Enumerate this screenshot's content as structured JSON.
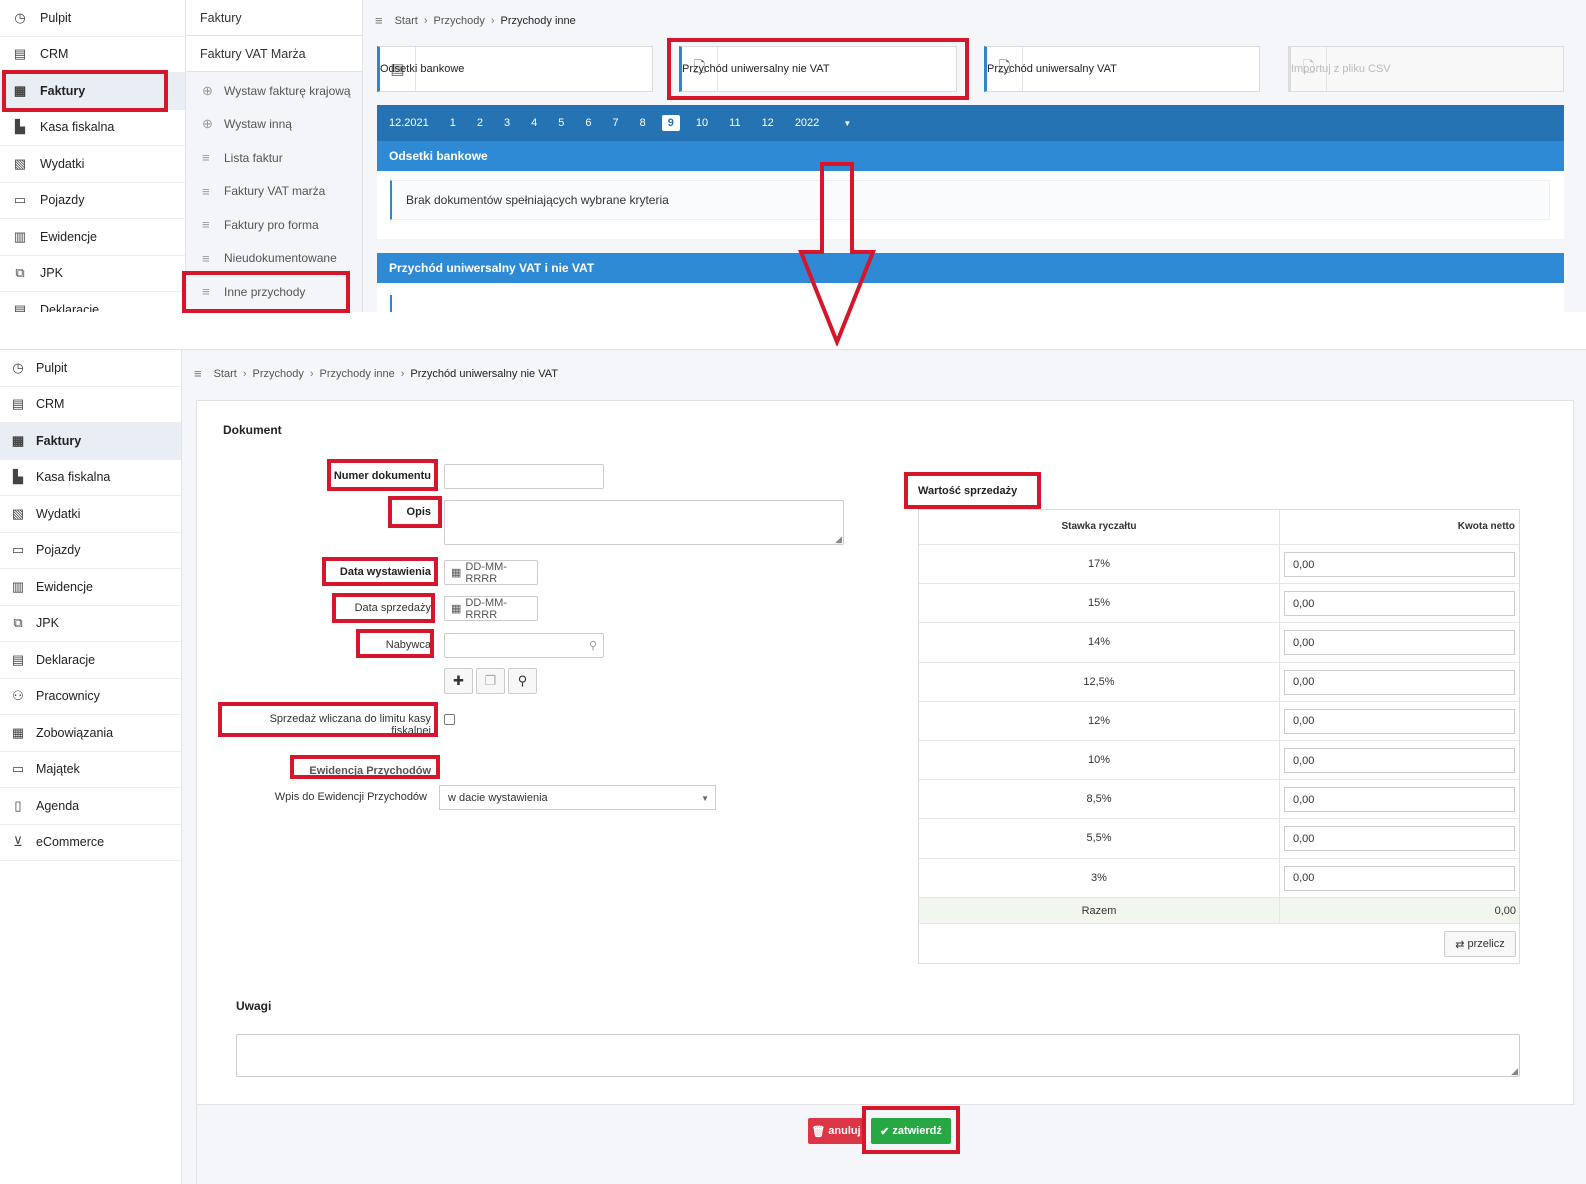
{
  "colors": {
    "accent": "#2f86c8",
    "month_bar": "#2673b3",
    "section_header": "#2f8ad6",
    "highlight": "#d6172b",
    "cancel": "#dc3545",
    "confirm": "#28a745"
  },
  "top": {
    "nav": [
      {
        "label": "Pulpit",
        "icon": "dashboard-icon"
      },
      {
        "label": "CRM",
        "icon": "crm-icon"
      },
      {
        "label": "Faktury",
        "icon": "invoice-icon"
      },
      {
        "label": "Kasa fiskalna",
        "icon": "cash-register-icon"
      },
      {
        "label": "Wydatki",
        "icon": "expenses-icon"
      },
      {
        "label": "Pojazdy",
        "icon": "car-icon"
      },
      {
        "label": "Ewidencje",
        "icon": "records-icon"
      },
      {
        "label": "JPK",
        "icon": "jpk-icon"
      },
      {
        "label": "Deklaracje",
        "icon": "declarations-icon"
      }
    ],
    "subnav": {
      "headers": [
        "Faktury",
        "Faktury VAT Marża"
      ],
      "items": [
        "Wystaw fakturę krajową",
        "Wystaw inną",
        "Lista faktur",
        "Faktury VAT marża",
        "Faktury pro forma",
        "Nieudokumentowane",
        "Inne przychody"
      ]
    },
    "breadcrumb": [
      "Start",
      "Przychody",
      "Przychody inne"
    ],
    "actions": [
      "Odsetki bankowe",
      "Przychód uniwersalny nie VAT",
      "Przychód uniwersalny VAT",
      "Importuj z pliku CSV"
    ],
    "months": {
      "start": "12.2021",
      "items": [
        "1",
        "2",
        "3",
        "4",
        "5",
        "6",
        "7",
        "8",
        "9",
        "10",
        "11",
        "12"
      ],
      "active": "9",
      "year": "2022"
    },
    "section1": {
      "title": "Odsetki bankowe",
      "empty": "Brak dokumentów spełniających wybrane kryteria"
    },
    "section2": {
      "title": "Przychód uniwersalny VAT i nie VAT"
    }
  },
  "bottom": {
    "nav": [
      {
        "label": "Pulpit",
        "icon": "dashboard-icon"
      },
      {
        "label": "CRM",
        "icon": "crm-icon"
      },
      {
        "label": "Faktury",
        "icon": "invoice-icon"
      },
      {
        "label": "Kasa fiskalna",
        "icon": "cash-register-icon"
      },
      {
        "label": "Wydatki",
        "icon": "expenses-icon"
      },
      {
        "label": "Pojazdy",
        "icon": "car-icon"
      },
      {
        "label": "Ewidencje",
        "icon": "records-icon"
      },
      {
        "label": "JPK",
        "icon": "jpk-icon"
      },
      {
        "label": "Deklaracje",
        "icon": "declarations-icon"
      },
      {
        "label": "Pracownicy",
        "icon": "employees-icon"
      },
      {
        "label": "Zobowiązania",
        "icon": "liabilities-icon"
      },
      {
        "label": "Majątek",
        "icon": "assets-icon"
      },
      {
        "label": "Agenda",
        "icon": "agenda-icon"
      },
      {
        "label": "eCommerce",
        "icon": "cart-icon"
      }
    ],
    "breadcrumb": [
      "Start",
      "Przychody",
      "Przychody inne",
      "Przychód uniwersalny nie VAT"
    ],
    "form": {
      "section_title": "Dokument",
      "numer_label": "Numer dokumentu",
      "numer_value": "",
      "opis_label": "Opis",
      "data_wyst_label": "Data wystawienia",
      "data_wyst_placeholder": "DD-MM-RRRR",
      "data_sprz_label": "Data sprzedaży",
      "data_sprz_placeholder": "DD-MM-RRRR",
      "nabywca_label": "Nabywca",
      "kasa_label": "Sprzedaż wliczana do limitu kasy fiskalnej",
      "ewidencja_title": "Ewidencja Przychodów",
      "wpis_label": "Wpis do Ewidencji Przychodów",
      "wpis_value": "w dacie wystawienia",
      "uwagi_label": "Uwagi"
    },
    "sales": {
      "title": "Wartość sprzedaży",
      "col1": "Stawka ryczałtu",
      "col2": "Kwota netto",
      "rows": [
        {
          "rate": "17%",
          "value": "0,00"
        },
        {
          "rate": "15%",
          "value": "0,00"
        },
        {
          "rate": "14%",
          "value": "0,00"
        },
        {
          "rate": "12,5%",
          "value": "0,00"
        },
        {
          "rate": "12%",
          "value": "0,00"
        },
        {
          "rate": "10%",
          "value": "0,00"
        },
        {
          "rate": "8,5%",
          "value": "0,00"
        },
        {
          "rate": "5,5%",
          "value": "0,00"
        },
        {
          "rate": "3%",
          "value": "0,00"
        }
      ],
      "total_label": "Razem",
      "total_value": "0,00",
      "recalc": "przelicz"
    },
    "buttons": {
      "cancel": "anuluj",
      "confirm": "zatwierdź"
    }
  }
}
